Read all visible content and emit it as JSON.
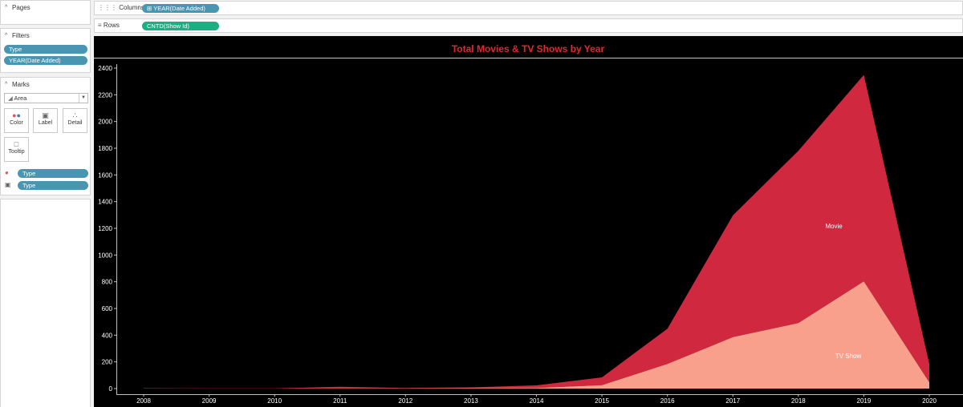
{
  "panels": {
    "pages": {
      "title": "Pages"
    },
    "filters": {
      "title": "Filters",
      "pills": [
        "Type",
        "YEAR(Date Added)"
      ]
    },
    "marks": {
      "title": "Marks",
      "mark_type": "Area",
      "buttons": {
        "color": "Color",
        "label": "Label",
        "detail": "Detail",
        "tooltip": "Tooltip"
      },
      "encodings": [
        {
          "kind": "color",
          "field": "Type"
        },
        {
          "kind": "label",
          "field": "Type"
        }
      ]
    }
  },
  "shelves": {
    "columns": {
      "label": "Columns",
      "pill": "YEAR(Date Added)"
    },
    "rows": {
      "label": "Rows",
      "pill": "CNTD(Show Id)"
    }
  },
  "colors": {
    "movie": "#d0283f",
    "tv_show": "#f9a08c",
    "title": "#e0282f",
    "background": "#000000"
  },
  "chart_data": {
    "type": "area",
    "stacked": true,
    "title": "Total Movies & TV Shows by Year",
    "x": [
      "2008",
      "2009",
      "2010",
      "2011",
      "2012",
      "2013",
      "2014",
      "2015",
      "2016",
      "2017",
      "2018",
      "2019",
      "2020"
    ],
    "series": [
      {
        "name": "TV Show",
        "values": [
          1,
          0,
          0,
          1,
          1,
          3,
          5,
          26,
          184,
          385,
          490,
          803,
          46
        ]
      },
      {
        "name": "Movie",
        "values": [
          1,
          2,
          1,
          13,
          4,
          6,
          19,
          58,
          264,
          913,
          1290,
          1546,
          138
        ]
      }
    ],
    "ylim": [
      0,
      2400
    ],
    "yticks": [
      0,
      200,
      400,
      600,
      800,
      1000,
      1200,
      1400,
      1600,
      1800,
      2000,
      2200,
      2400
    ],
    "grid": false
  }
}
